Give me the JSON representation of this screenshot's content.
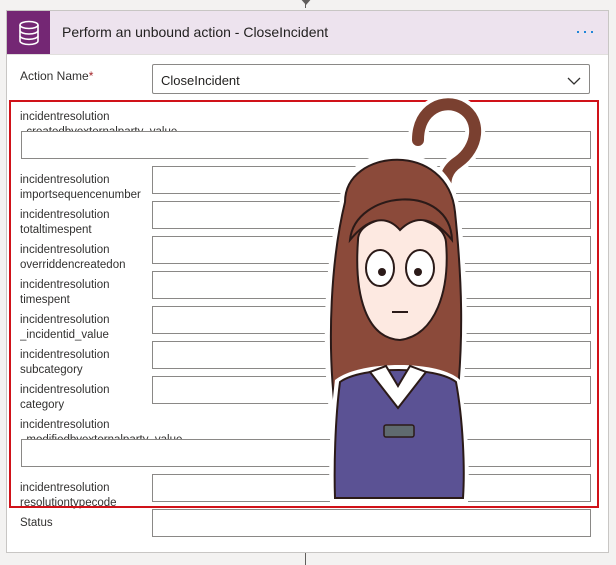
{
  "header": {
    "title": "Perform an unbound action - CloseIncident",
    "more_label": "···"
  },
  "action": {
    "label": "Action Name",
    "required_mark": "*",
    "value": "CloseIncident"
  },
  "fields": [
    {
      "line1": "incidentresolution",
      "line2": "_createdbyexternalparty_value"
    },
    {
      "line1": "incidentresolution",
      "line2": "importsequencenumber"
    },
    {
      "line1": "incidentresolution",
      "line2": "totaltimespent"
    },
    {
      "line1": "incidentresolution",
      "line2": "overriddencreatedon"
    },
    {
      "line1": "incidentresolution",
      "line2": "timespent"
    },
    {
      "line1": "incidentresolution",
      "line2": "_incidentid_value"
    },
    {
      "line1": "incidentresolution",
      "line2": "subcategory"
    },
    {
      "line1": "incidentresolution",
      "line2": "category"
    },
    {
      "line1": "incidentresolution",
      "line2": "_modifiedbyexternalparty_value"
    },
    {
      "line1": "incidentresolution",
      "line2": "resolutiontypecode"
    }
  ],
  "status": {
    "label": "Status"
  },
  "colors": {
    "header_bg": "#ede3ee",
    "icon_bg": "#742774",
    "highlight": "#d01219",
    "accent": "#0078d4"
  },
  "icons": {
    "header": "database-icon",
    "select": "chevron-down-icon"
  }
}
